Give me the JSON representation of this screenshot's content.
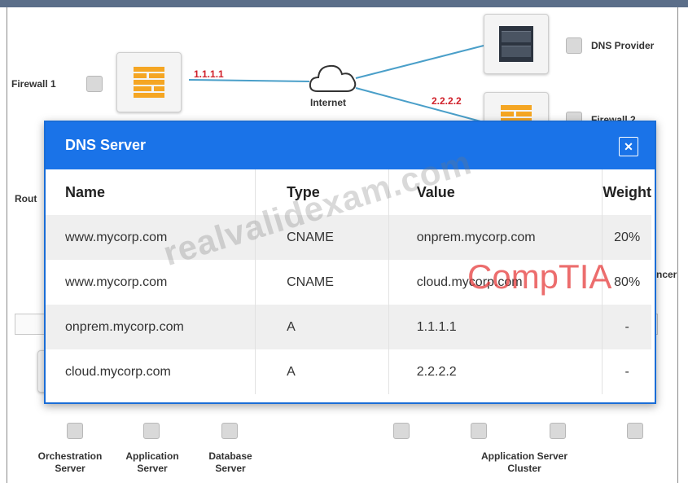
{
  "diagram": {
    "nodes": {
      "firewall1": "Firewall 1",
      "internet": "Internet",
      "dns_provider": "DNS Provider",
      "firewall2": "Firewall 2",
      "router": "Rout",
      "load_balancer": "ncer",
      "orchestration_server": "Orchestration Server",
      "application_server": "Application Server",
      "database_server": "Database Server",
      "application_server_cluster": "Application Server Cluster"
    },
    "ip_labels": {
      "firewall1_link": "1.1.1.1",
      "firewall2_link": "2.2.2.2"
    }
  },
  "dialog": {
    "title": "DNS Server",
    "close_icon": "close-icon",
    "columns": [
      "Name",
      "Type",
      "Value",
      "Weight"
    ],
    "rows": [
      {
        "name": "www.mycorp.com",
        "type": "CNAME",
        "value": "onprem.mycorp.com",
        "weight": "20%"
      },
      {
        "name": "www.mycorp.com",
        "type": "CNAME",
        "value": "cloud.mycorp.com",
        "weight": "80%"
      },
      {
        "name": "onprem.mycorp.com",
        "type": "A",
        "value": "1.1.1.1",
        "weight": "-"
      },
      {
        "name": "cloud.mycorp.com",
        "type": "A",
        "value": "2.2.2.2",
        "weight": "-"
      }
    ]
  },
  "watermarks": {
    "site": "realvalidexam.com",
    "brand": "CompTIA"
  },
  "colors": {
    "dialog_header": "#1a73e8",
    "ip_label": "#d0202a",
    "firewall": "#f5a623",
    "link_line": "#4a9fc9"
  }
}
